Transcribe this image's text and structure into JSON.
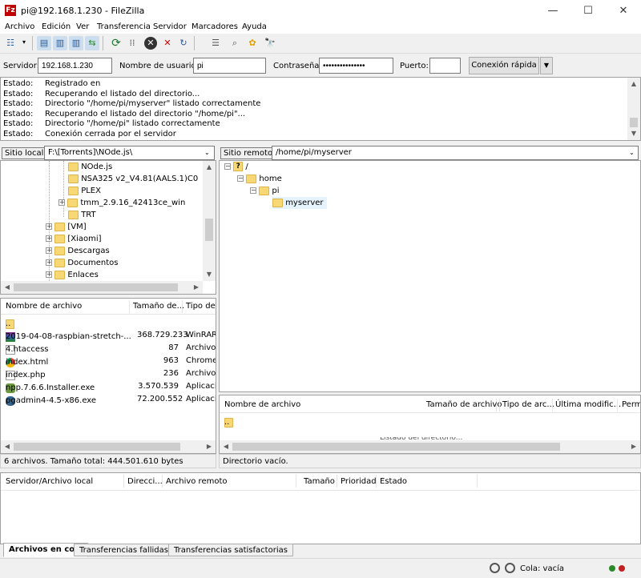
{
  "window": {
    "title": "pi@192.168.1.230 - FileZilla"
  },
  "menu": [
    "Archivo",
    "Edición",
    "Ver",
    "Transferencia",
    "Servidor",
    "Marcadores",
    "Ayuda"
  ],
  "quickconnect": {
    "server_label": "Servidor:",
    "server_value": "192.168.1.230",
    "user_label": "Nombre de usuario:",
    "user_value": "pi",
    "pass_label": "Contraseña:",
    "pass_value": "•••••••••••••••",
    "port_label": "Puerto:",
    "port_value": "",
    "connect_label": "Conexión rápida"
  },
  "log": [
    {
      "k": "Estado:",
      "v": "Registrado en"
    },
    {
      "k": "Estado:",
      "v": "Recuperando el listado del directorio..."
    },
    {
      "k": "Estado:",
      "v": "Directorio \"/home/pi/myserver\" listado correctamente"
    },
    {
      "k": "Estado:",
      "v": "Recuperando el listado del directorio \"/home/pi\"..."
    },
    {
      "k": "Estado:",
      "v": "Directorio \"/home/pi\" listado correctamente"
    },
    {
      "k": "Estado:",
      "v": "Conexión cerrada por el servidor"
    }
  ],
  "local": {
    "site_label": "Sitio local:",
    "site_path": "F:\\[Torrents]\\NOde.js\\",
    "tree": [
      "NOde.js",
      "NSA325 v2_V4.81(AALS.1)C0",
      "PLEX",
      "tmm_2.9.16_42413ce_win",
      "TRT",
      "[VM]",
      "[Xiaomi]",
      "Descargas",
      "Documentos",
      "Enlaces"
    ],
    "columns": {
      "name": "Nombre de archivo",
      "size": "Tamaño de...",
      "type": "Tipo de"
    },
    "files": [
      {
        "name": "..",
        "size": "",
        "type": ""
      },
      {
        "name": "2019-04-08-raspbian-stretch-...",
        "size": "368.729.233",
        "type": "WinRAR"
      },
      {
        "name": "4.htaccess",
        "size": "87",
        "type": "Archivo"
      },
      {
        "name": "index.html",
        "size": "963",
        "type": "Chrome"
      },
      {
        "name": "index.php",
        "size": "236",
        "type": "Archivo"
      },
      {
        "name": "npp.7.6.6.Installer.exe",
        "size": "3.570.539",
        "type": "Aplicaci"
      },
      {
        "name": "pgadmin4-4.5-x86.exe",
        "size": "72.200.552",
        "type": "Aplicaci"
      }
    ],
    "status": "6 archivos. Tamaño total: 444.501.610 bytes"
  },
  "remote": {
    "site_label": "Sitio remoto:",
    "site_path": "/home/pi/myserver",
    "tree": [
      "/",
      "home",
      "pi",
      "myserver"
    ],
    "columns": {
      "name": "Nombre de archivo",
      "size": "Tamaño de archivo",
      "type": "Tipo de arc...",
      "modified": "Última modific...",
      "perm": "Perm"
    },
    "files": [
      {
        "name": ".."
      }
    ],
    "overlay": "Listado del directorio...",
    "status": "Directorio vacío."
  },
  "queue": {
    "columns": {
      "server": "Servidor/Archivo local",
      "dir": "Direcci...",
      "remote": "Archivo remoto",
      "size": "Tamaño",
      "prio": "Prioridad",
      "state": "Estado"
    },
    "tabs": [
      "Archivos en cola",
      "Transferencias fallidas",
      "Transferencias satisfactorias"
    ]
  },
  "statusbar": {
    "queue": "Cola: vacía"
  }
}
